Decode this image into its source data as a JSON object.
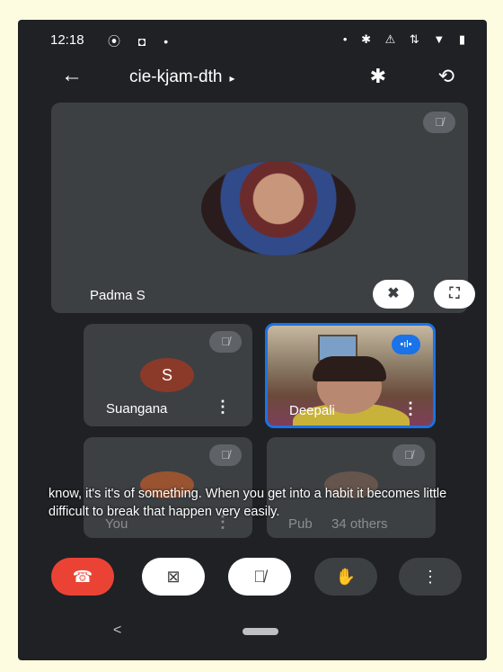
{
  "status_bar": {
    "time": "12:18",
    "left_icons": "⦿ ◘ •",
    "right_icons": "• ✱ ⚠ ⇅ ▼ ▮"
  },
  "topbar": {
    "back_icon": "←",
    "meeting_code": "cie-kjam-dth",
    "caret": "▸",
    "bluetooth_icon": "✱",
    "switch_camera_icon": "⟲"
  },
  "main_tile": {
    "name": "Padma S",
    "mic_icon": "🎙̸",
    "unpin_icon": "✖",
    "fullscreen_icon": "⛶"
  },
  "participants": [
    {
      "name": "Suangana",
      "initial": "S",
      "mic_icon": "🎙̸",
      "menu_icon": "⋮"
    },
    {
      "name": "Deepali",
      "speaking_icon": "•ıl•",
      "menu_icon": "⋮"
    },
    {
      "name": "You",
      "mic_icon": "🎙̸",
      "menu_icon": "⋮"
    },
    {
      "name": "Pub",
      "others_label": "34 others",
      "mic_icon": "🎙̸"
    }
  ],
  "caption": "know, it's it's of something. When you get into a habit it becomes little difficult to break that happen very easily.",
  "controls": {
    "end_call_icon": "☎",
    "camera_off_icon": "⊠",
    "mic_off_icon": "🎙̸",
    "raise_hand_icon": "✋",
    "more_icon": "⋮"
  },
  "nav": {
    "back_icon": "<"
  },
  "colors": {
    "end_call": "#ea4335",
    "speaking_border": "#1a73e8",
    "tile_bg": "#3c4043"
  }
}
